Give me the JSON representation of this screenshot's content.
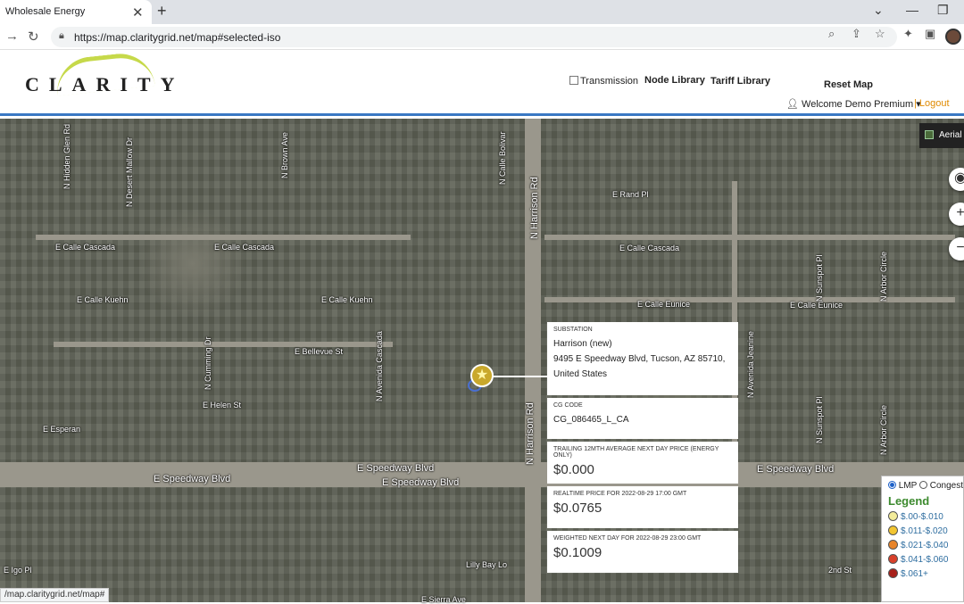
{
  "browser": {
    "tab_title": "Wholesale Energy",
    "url": "https://map.claritygrid.net/map#selected-iso",
    "status_url": "/map.claritygrid.net/map#"
  },
  "header": {
    "logo": "CLARITY",
    "transmission_label": "Transmission",
    "node_library": "Node Library",
    "tariff_library": "Tariff Library",
    "reset_map": "Reset Map",
    "welcome": "Welcome Demo Premium",
    "logout": "| Logout"
  },
  "map": {
    "aerial_label": "Aerial",
    "streets": {
      "hidden_glen": "N Hidden Glen Rd",
      "desert_mallow": "N Desert Mallow Dr",
      "brown_ave": "N Brown Ave",
      "calle_bolivar": "N Calle Bolivar",
      "harrison_upper": "N Harrison Rd",
      "harrison_lower": "N Harrison Rd",
      "rand": "E Rand Pl",
      "cascada_1": "E Calle Cascada",
      "cascada_2": "E Calle Cascada",
      "cascada_3": "E Calle Cascada",
      "kuehn_1": "E Calle Kuehn",
      "kuehn_2": "E Calle Kuehn",
      "eunice_1": "E Calle Eunice",
      "eunice_2": "E Calle Eunice",
      "bellevue": "E Bellevue St",
      "cumming": "N Cumming Dr",
      "avenida_cascada": "N Avenida Cascada",
      "helen": "E Helen St",
      "esperanza": "E Esperan",
      "speedway_1": "E Speedway Blvd",
      "speedway_2": "E Speedway Blvd",
      "speedway_3": "E Speedway Blvd",
      "speedway_4": "E Speedway Blvd",
      "avenida_jeanine": "N Avenida Jeanine",
      "sunspot_1": "N Sunspot Pl",
      "sunspot_2": "N Sunspot Pl",
      "arbor_circle_1": "N Arbor Circle",
      "arbor_circle_2": "N Arbor Circle",
      "rand_2": "E Rand Pl",
      "igo": "E Igo Pl",
      "sierra": "E Sierra Ave",
      "lilly_bay": "Lilly Bay Lo",
      "second_st": "2nd St"
    }
  },
  "substation": {
    "type_label": "SUBSTATION",
    "name": "Harrison (new)",
    "address_line1": "9495 E Speedway Blvd, Tucson, AZ 85710,",
    "address_line2": "United States",
    "code_label": "CG CODE",
    "code": "CG_086465_L_CA",
    "trailing_label": "TRAILING 12mth AVERAGE NEXT DAY PRICE (Energy only)",
    "trailing_value": "$0.000",
    "realtime_label": "REALTIME PRICE FOR 2022-08-29 17:00 GMT",
    "realtime_value": "$0.0765",
    "weighted_label": "WEIGHTED NEXT DAY FOR 2022-08-29 23:00 GMT",
    "weighted_value": "$0.1009"
  },
  "legend": {
    "lmp_label": "LMP",
    "congest_label": "Congest",
    "title": "Legend",
    "items": [
      {
        "label": "$.00-$.010",
        "color": "#f3ec9a"
      },
      {
        "label": "$.011-$.020",
        "color": "#f2c531"
      },
      {
        "label": "$.021-$.040",
        "color": "#e8842a"
      },
      {
        "label": "$.041-$.060",
        "color": "#d9402a"
      },
      {
        "label": "$.061+",
        "color": "#a8201a"
      }
    ]
  }
}
